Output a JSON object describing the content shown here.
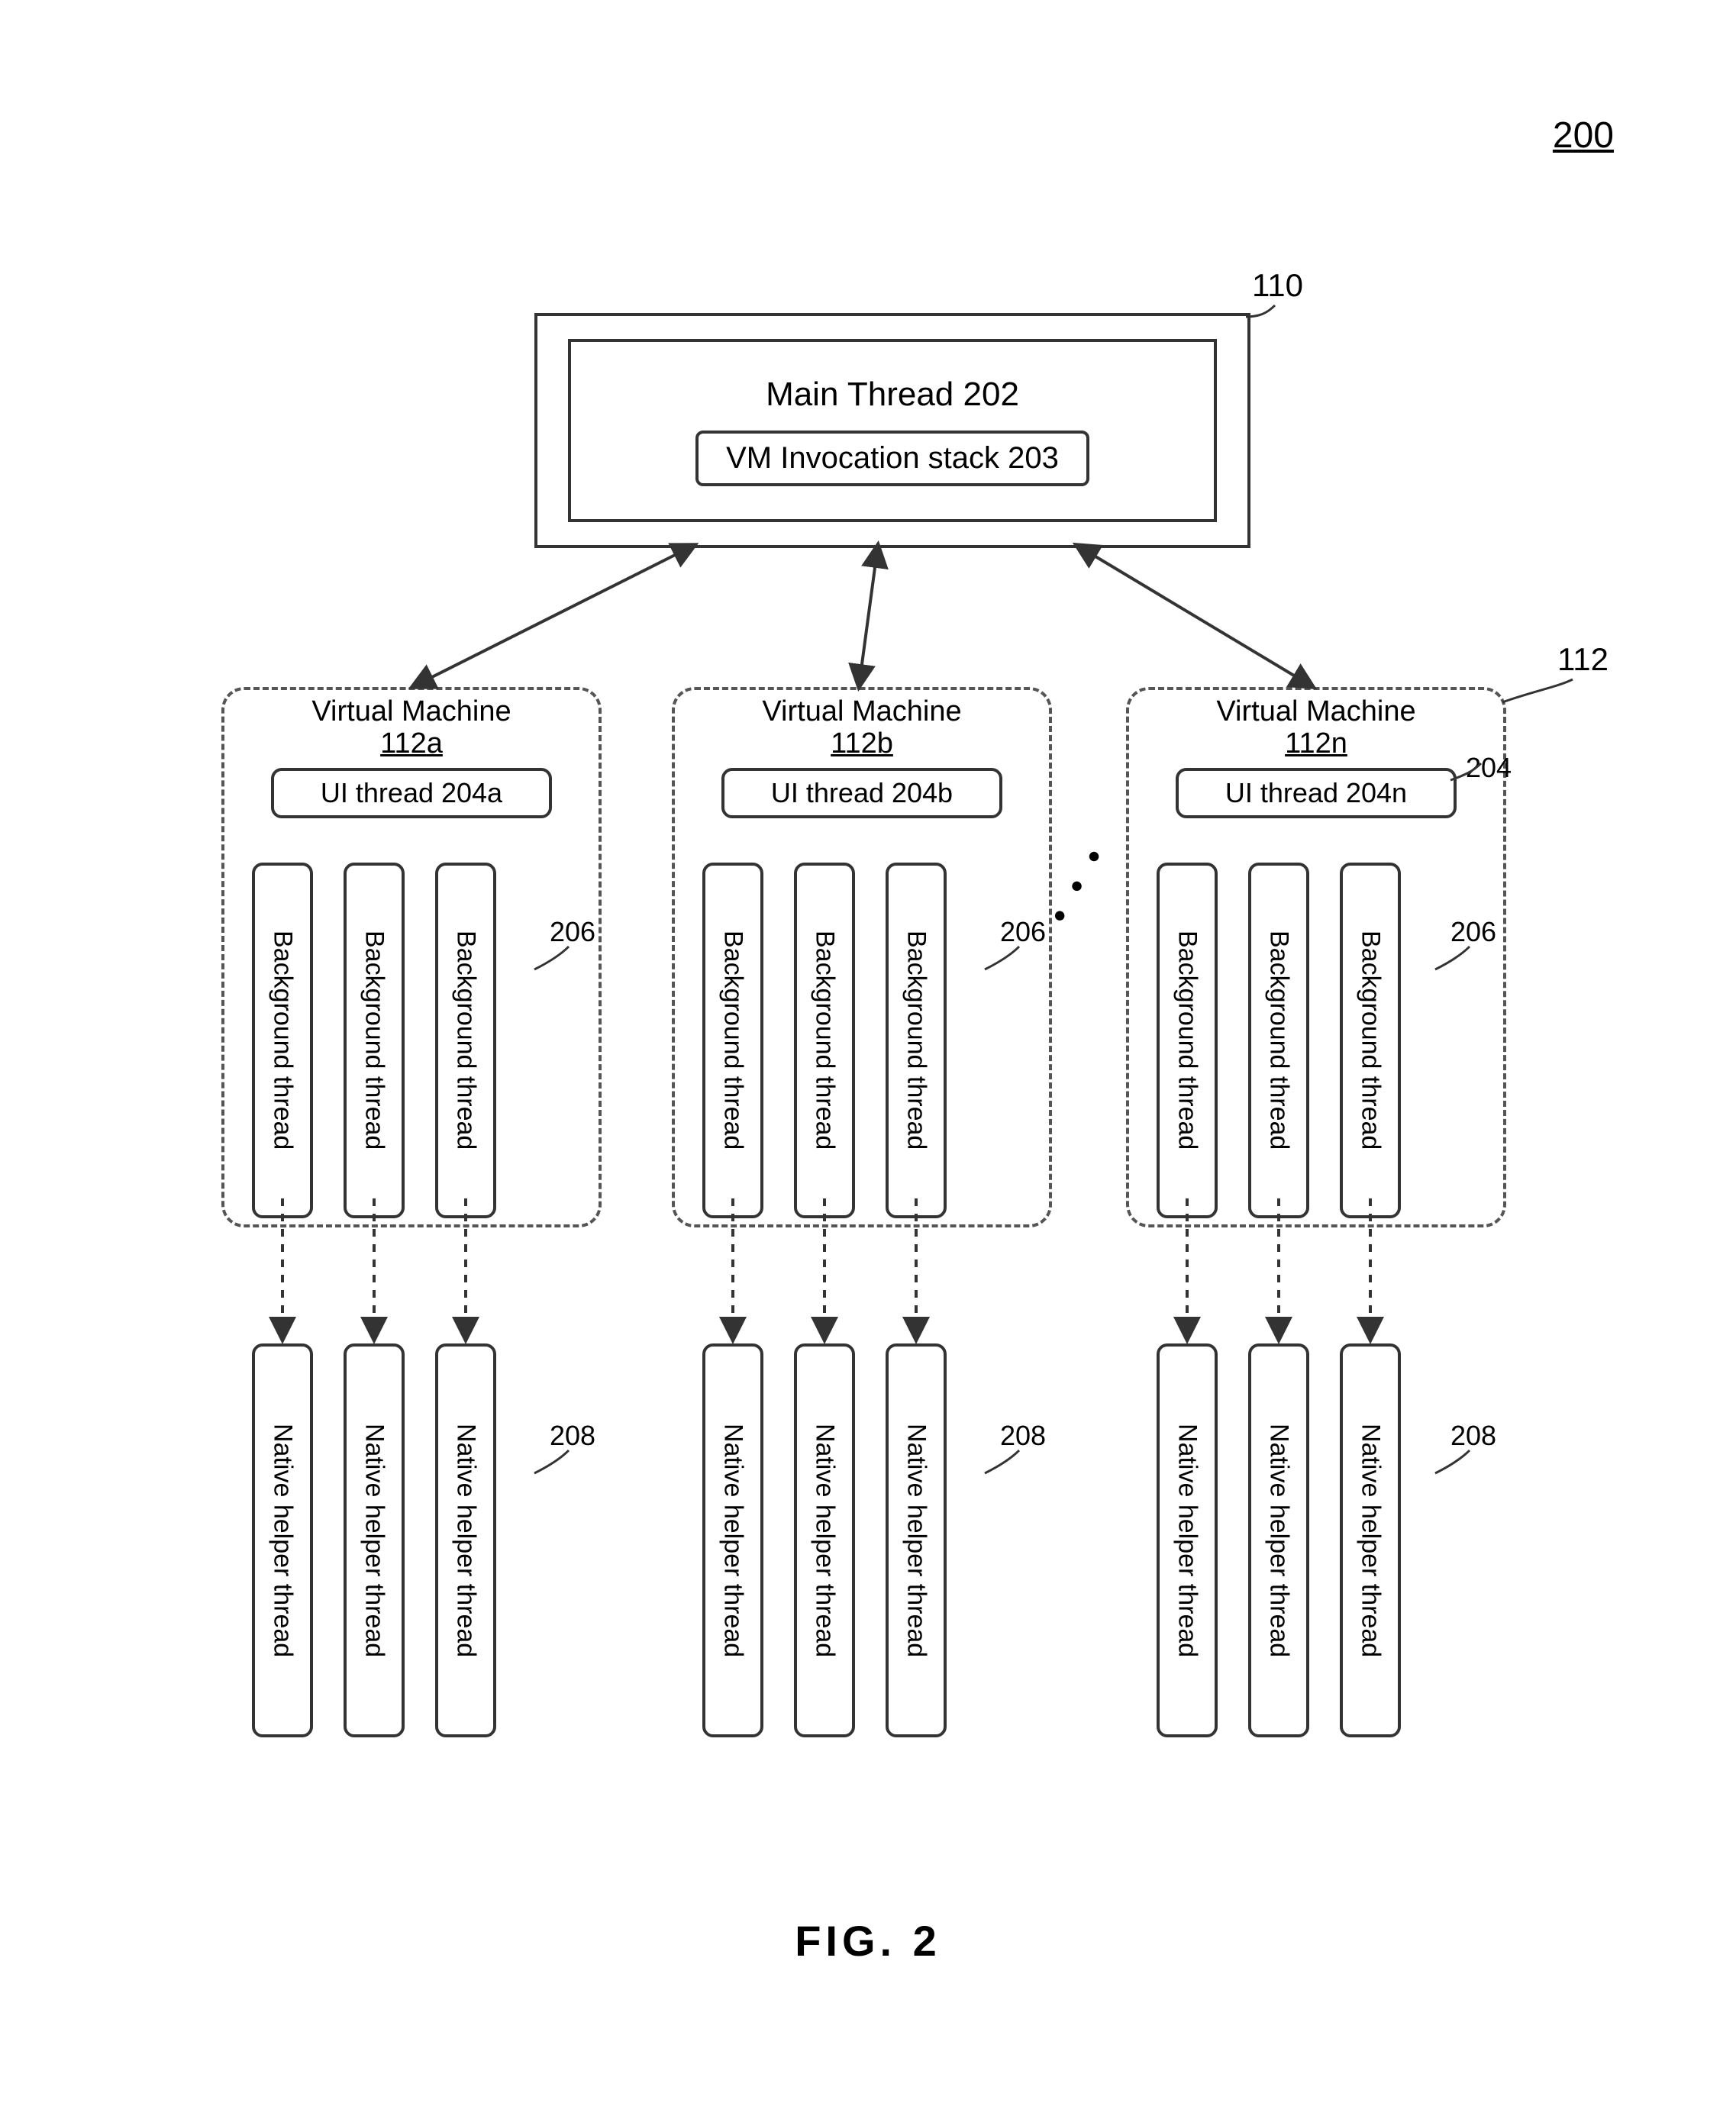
{
  "figure": {
    "number": "200",
    "caption": "FIG. 2",
    "ref110": "110",
    "ref112": "112",
    "ref204": "204",
    "ref206": "206",
    "ref208": "208"
  },
  "main": {
    "title": "Main Thread 202",
    "stack": "VM Invocation stack 203"
  },
  "vm": {
    "a": {
      "title1": "Virtual Machine",
      "title2": "112a",
      "ui": "UI thread 204a"
    },
    "b": {
      "title1": "Virtual Machine",
      "title2": "112b",
      "ui": "UI thread 204b"
    },
    "n": {
      "title1": "Virtual Machine",
      "title2": "112n",
      "ui": "UI thread 204n"
    }
  },
  "threads": {
    "bg": "Background thread",
    "nh": "Native helper thread"
  }
}
